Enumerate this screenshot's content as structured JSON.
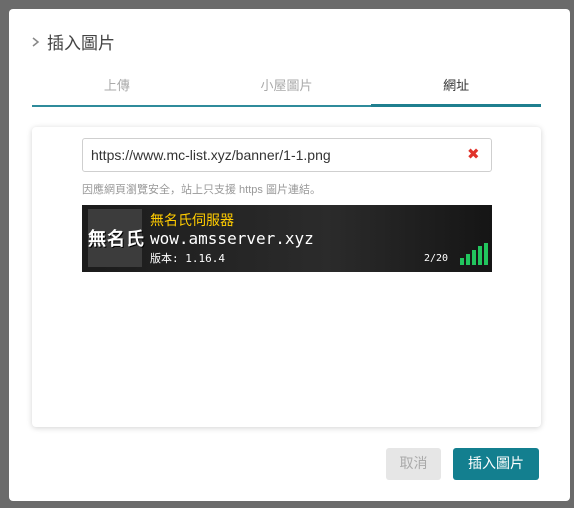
{
  "dialog": {
    "title": "插入圖片"
  },
  "tabs": [
    {
      "label": "上傳"
    },
    {
      "label": "小屋圖片"
    },
    {
      "label": "網址"
    }
  ],
  "url_field": {
    "value": "https://www.mc-list.xyz/banner/1-1.png"
  },
  "hint": "因應網頁瀏覽安全，站上只支援 https 圖片連結。",
  "banner": {
    "logo_text": "無名氏",
    "server_name": "無名氏伺服器",
    "domain": "wow.amsserver.xyz",
    "version": "版本: 1.16.4",
    "players": "2/20"
  },
  "buttons": {
    "cancel": "取消",
    "insert": "插入圖片"
  },
  "colors": {
    "accent": "#137f8f",
    "clear": "#e0332b"
  }
}
